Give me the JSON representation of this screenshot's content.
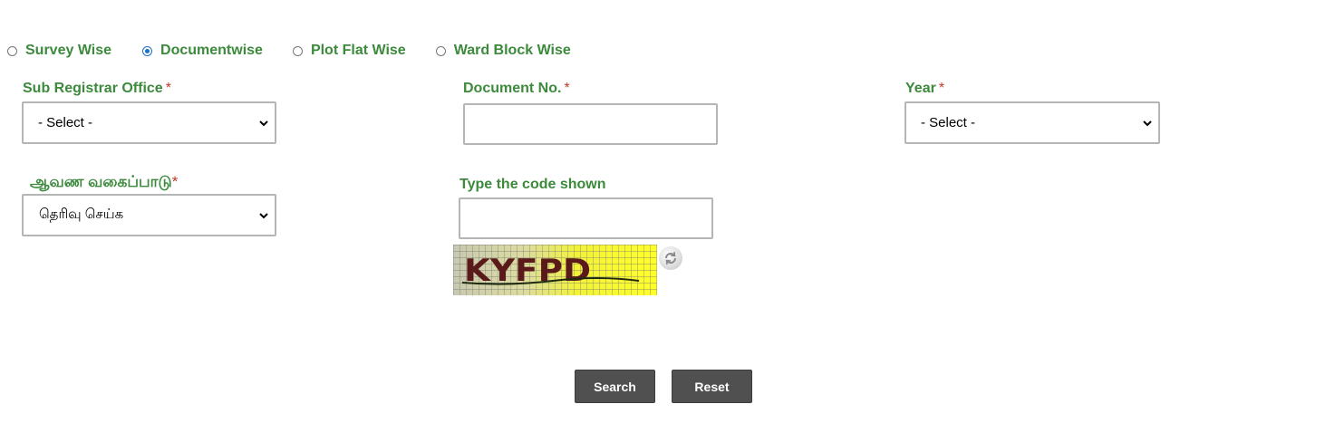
{
  "search_modes": [
    {
      "label": "Survey Wise",
      "checked": false
    },
    {
      "label": "Documentwise",
      "checked": true
    },
    {
      "label": "Plot Flat Wise",
      "checked": false
    },
    {
      "label": "Ward Block Wise",
      "checked": false
    }
  ],
  "fields": {
    "sro": {
      "label": "Sub Registrar Office",
      "required_mark": "*",
      "selected": "- Select -"
    },
    "doc_no": {
      "label": "Document No.",
      "required_mark": "*",
      "value": ""
    },
    "year": {
      "label": "Year",
      "required_mark": "*",
      "selected": "- Select -"
    },
    "doc_type": {
      "label": "ஆவண வகைப்பாடு",
      "required_mark": "*",
      "selected": "தெரிவு செய்க"
    },
    "captcha": {
      "label": "Type the code shown",
      "value": "",
      "image_text": "KYFPD"
    }
  },
  "buttons": {
    "search": "Search",
    "reset": "Reset"
  },
  "colors": {
    "label_green": "#3c8a3c",
    "required_red": "#c0392b",
    "radio_blue": "#1a73c9",
    "button_gray": "#505050"
  },
  "icons": {
    "dropdown": "chevron-down-icon",
    "captcha_refresh": "refresh-icon"
  }
}
